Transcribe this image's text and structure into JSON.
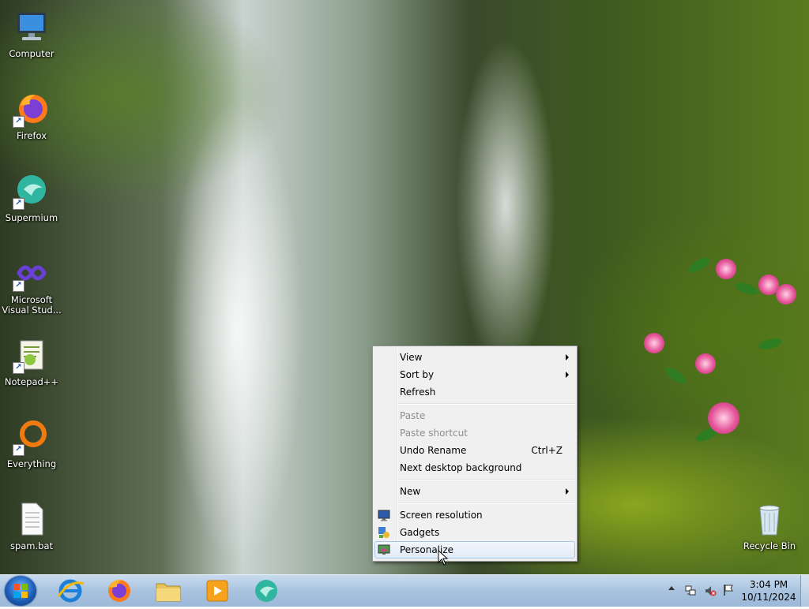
{
  "desktop": {
    "icons": [
      {
        "label": "Computer"
      },
      {
        "label": "Firefox"
      },
      {
        "label": "Supermium"
      },
      {
        "label": "Microsoft Visual Stud..."
      },
      {
        "label": "Notepad++"
      },
      {
        "label": "Everything"
      },
      {
        "label": "spam.bat"
      },
      {
        "label": "Recycle Bin"
      }
    ]
  },
  "context_menu": {
    "items": [
      {
        "label": "View",
        "submenu": true
      },
      {
        "label": "Sort by",
        "submenu": true
      },
      {
        "label": "Refresh"
      },
      {
        "label": "Paste",
        "disabled": true
      },
      {
        "label": "Paste shortcut",
        "disabled": true
      },
      {
        "label": "Undo Rename",
        "shortcut": "Ctrl+Z"
      },
      {
        "label": "Next desktop background"
      },
      {
        "label": "New",
        "submenu": true
      },
      {
        "label": "Screen resolution",
        "icon": "screen-resolution-icon"
      },
      {
        "label": "Gadgets",
        "icon": "gadgets-icon"
      },
      {
        "label": "Personalize",
        "icon": "personalize-icon",
        "highlighted": true
      }
    ]
  },
  "taskbar": {
    "pinned": [
      "internet-explorer-icon",
      "firefox-icon",
      "file-explorer-icon",
      "media-player-icon",
      "supermium-icon"
    ],
    "clock": {
      "time": "3:04 PM",
      "date": "10/11/2024"
    }
  }
}
